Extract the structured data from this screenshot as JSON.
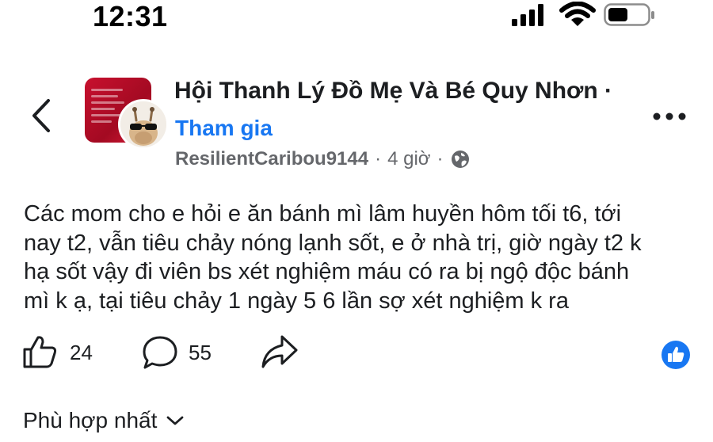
{
  "status_bar": {
    "time": "12:31",
    "icons": [
      "signal-icon",
      "wifi-icon",
      "battery-icon"
    ]
  },
  "header": {
    "back_icon": "chevron-left-icon",
    "group_name": "Hội Thanh Lý Đồ Mẹ Và Bé Quy Nhơn ·",
    "join_label": "Tham gia",
    "author": "ResilientCaribou9144",
    "separator": "·",
    "time_ago": "4 giờ",
    "separator2": "·",
    "privacy_icon": "globe-icon",
    "more_icon": "more-horizontal-icon"
  },
  "post": {
    "text": "Các mom cho e hỏi e ăn bánh mì lâm huyền hôm tối t6, tới\nnay t2, vẫn tiêu chảy nóng lạnh sốt, e ở nhà trị, giờ ngày t2 k\nhạ sốt vậy đi viên bs xét nghiệm máu có ra bị ngộ độc bánh\nmì k ạ, tại tiêu chảy 1 ngày 5 6 lần sợ xét nghiệm k ra"
  },
  "actions": {
    "like_icon": "thumbs-up-icon",
    "like_count": "24",
    "comment_icon": "comment-icon",
    "comment_count": "55",
    "share_icon": "share-icon",
    "reaction_icon": "like-reaction-icon"
  },
  "sort": {
    "label": "Phù hợp nhất",
    "icon": "chevron-down-icon"
  },
  "colors": {
    "accent": "#1877f2",
    "text": "#1c1e21",
    "secondary": "#65676b"
  }
}
